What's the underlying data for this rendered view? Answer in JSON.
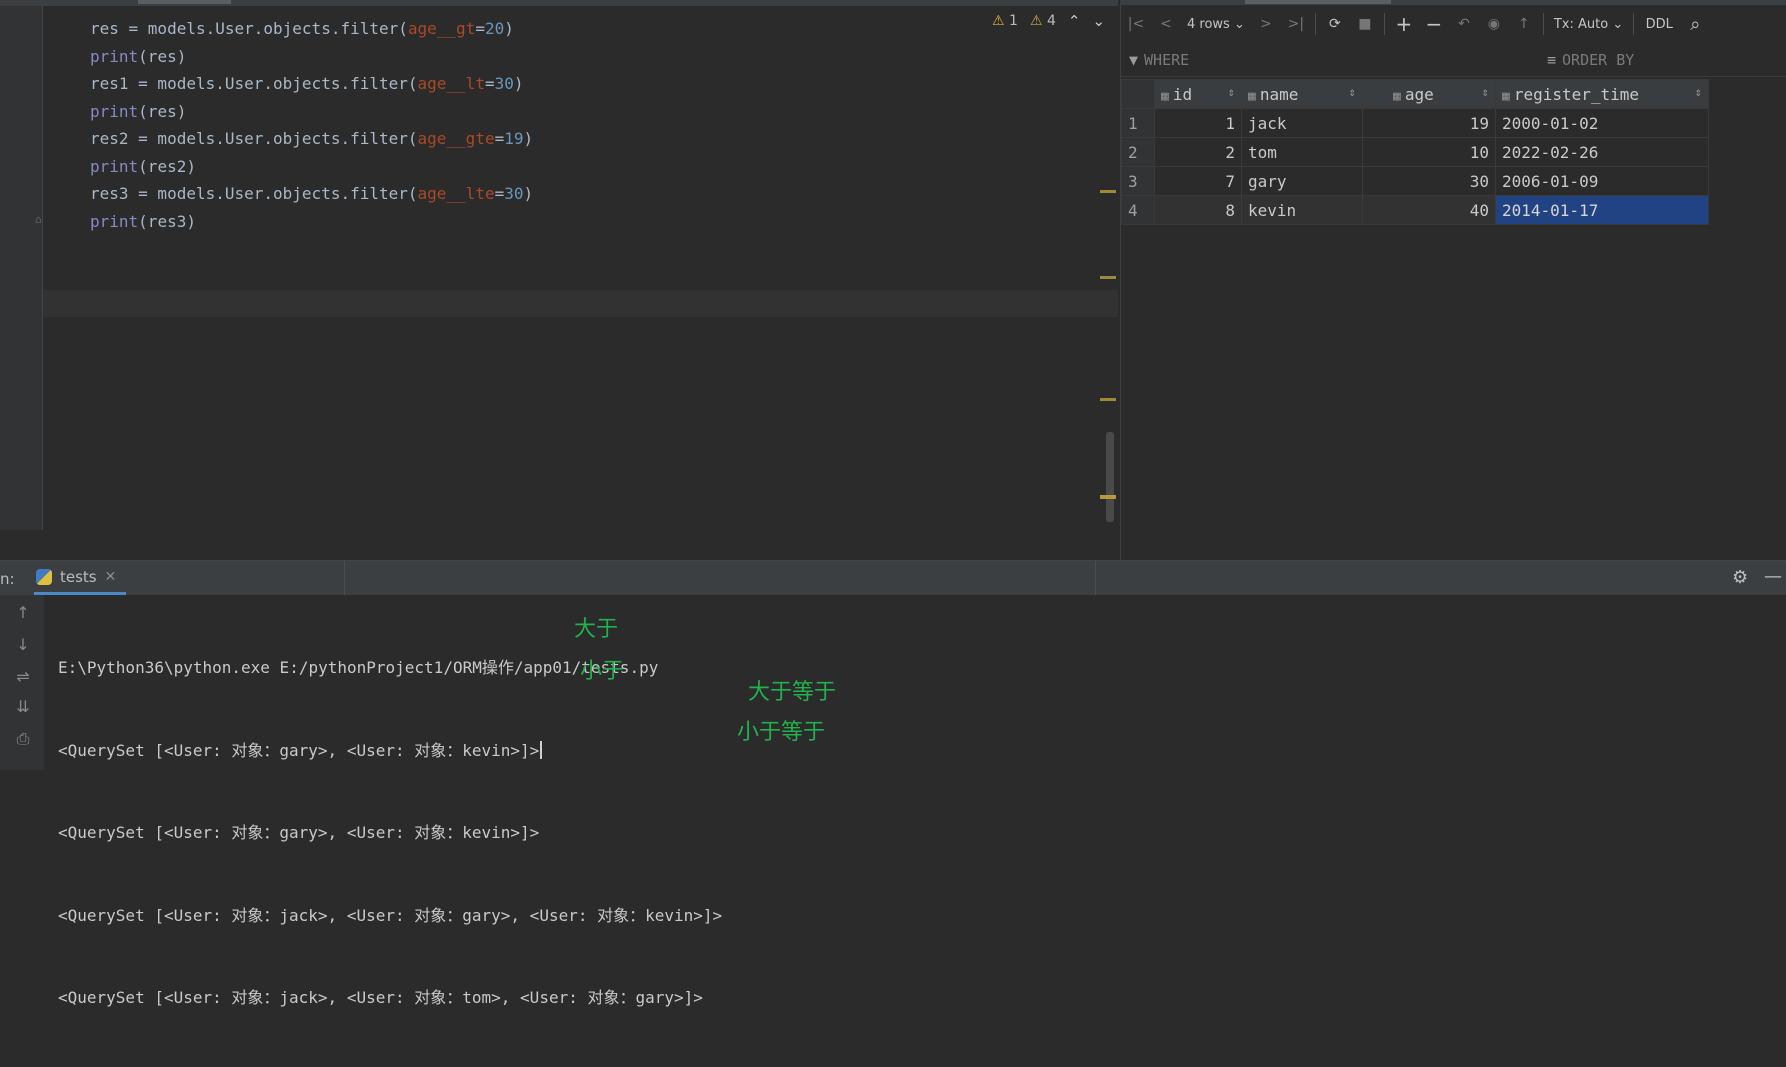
{
  "editor": {
    "lines": [
      [
        {
          "t": "res = models.User.objects.filter(",
          "c": "tx"
        },
        {
          "t": "age__gt",
          "c": "pa"
        },
        {
          "t": "=",
          "c": "tx"
        },
        {
          "t": "20",
          "c": "nu"
        },
        {
          "t": ")",
          "c": "tx"
        }
      ],
      [
        {
          "t": "print",
          "c": "kw"
        },
        {
          "t": "(res)",
          "c": "tx"
        }
      ],
      [
        {
          "t": "res1 = models.User.objects.filter(",
          "c": "tx"
        },
        {
          "t": "age__lt",
          "c": "pa"
        },
        {
          "t": "=",
          "c": "tx"
        },
        {
          "t": "30",
          "c": "nu"
        },
        {
          "t": ")",
          "c": "tx"
        }
      ],
      [
        {
          "t": "print",
          "c": "kw"
        },
        {
          "t": "(res)",
          "c": "tx"
        }
      ],
      [
        {
          "t": "res2 = models.User.objects.filter(",
          "c": "tx"
        },
        {
          "t": "age__gte",
          "c": "pa"
        },
        {
          "t": "=",
          "c": "tx"
        },
        {
          "t": "19",
          "c": "nu"
        },
        {
          "t": ")",
          "c": "tx"
        }
      ],
      [
        {
          "t": "print",
          "c": "kw"
        },
        {
          "t": "(res2)",
          "c": "tx"
        }
      ],
      [
        {
          "t": "res3 = models.User.objects.filter(",
          "c": "tx"
        },
        {
          "t": "age__lte",
          "c": "pa"
        },
        {
          "t": "=",
          "c": "tx"
        },
        {
          "t": "30",
          "c": "nu"
        },
        {
          "t": ")",
          "c": "tx"
        }
      ],
      [
        {
          "t": "print",
          "c": "kw"
        },
        {
          "t": "(res3)",
          "c": "tx"
        }
      ]
    ],
    "inspections": {
      "warnings_yellow": "1",
      "warnings_weak": "4"
    }
  },
  "db": {
    "rows_label": "4 rows",
    "tx_label": "Tx: Auto",
    "ddl_label": "DDL",
    "where_label": "WHERE",
    "orderby_label": "ORDER BY",
    "columns": [
      "id",
      "name",
      "age",
      "register_time"
    ],
    "rows": [
      {
        "rownum": "1",
        "id": "1",
        "name": "jack",
        "age": "19",
        "register_time": "2000-01-02"
      },
      {
        "rownum": "2",
        "id": "2",
        "name": "tom",
        "age": "10",
        "register_time": "2022-02-26"
      },
      {
        "rownum": "3",
        "id": "7",
        "name": "gary",
        "age": "30",
        "register_time": "2006-01-09"
      },
      {
        "rownum": "4",
        "id": "8",
        "name": "kevin",
        "age": "40",
        "register_time": "2014-01-17"
      }
    ]
  },
  "run": {
    "panel_label": "n:",
    "tab_label": "tests",
    "output": [
      "E:\\Python36\\python.exe E:/pythonProject1/ORM操作/app01/tests.py",
      "<QuerySet [<User: 对象：gary>, <User: 对象：kevin>]>",
      "<QuerySet [<User: 对象：gary>, <User: 对象：kevin>]>",
      "<QuerySet [<User: 对象：jack>, <User: 对象：gary>, <User: 对象：kevin>]>",
      "<QuerySet [<User: 对象：jack>, <User: 对象：tom>, <User: 对象：gary>]>"
    ],
    "annotations": [
      "大于",
      "小于",
      "大于等于",
      "小于等于"
    ]
  }
}
